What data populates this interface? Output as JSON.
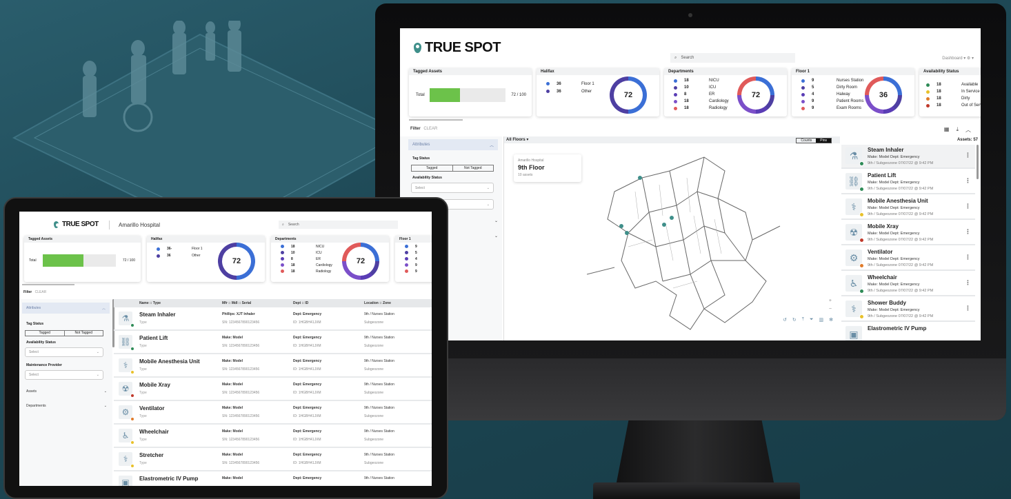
{
  "desktop": {
    "logo": "TRUE SPOT",
    "search_placeholder": "Search",
    "menu": "Dashboard ▾   ⚙ ▾",
    "tagged": {
      "title": "Tagged Assets",
      "label": "Total",
      "value": "72 / 100",
      "fraction": 0.72
    },
    "halifax": {
      "title": "Halifax",
      "total": "72",
      "items": [
        {
          "count": "36",
          "label": "Floor 1",
          "color": "#3b6fd6"
        },
        {
          "count": "36",
          "label": "Other",
          "color": "#4e3fa2"
        }
      ]
    },
    "departments": {
      "title": "Departments",
      "total": "72",
      "items": [
        {
          "count": "18",
          "label": "NICU",
          "color": "#3b6fd6"
        },
        {
          "count": "10",
          "label": "ICU",
          "color": "#4e3fa2"
        },
        {
          "count": "8",
          "label": "ER",
          "color": "#5a3db5"
        },
        {
          "count": "18",
          "label": "Cardiology",
          "color": "#7b4fc9"
        },
        {
          "count": "18",
          "label": "Radiology",
          "color": "#e05a5a"
        }
      ]
    },
    "floor1": {
      "title": "Floor 1",
      "total": "36",
      "items": [
        {
          "count": "9",
          "label": "Nurses Station",
          "color": "#3b6fd6"
        },
        {
          "count": "5",
          "label": "Dirty Room",
          "color": "#4e3fa2"
        },
        {
          "count": "4",
          "label": "Halway",
          "color": "#5a3db5"
        },
        {
          "count": "9",
          "label": "Patient Rooms",
          "color": "#7b4fc9"
        },
        {
          "count": "9",
          "label": "Exam Rooms",
          "color": "#e05a5a"
        }
      ]
    },
    "availability": {
      "title": "Availability Status",
      "items": [
        {
          "count": "18",
          "label": "Available",
          "color": "#2e8b57"
        },
        {
          "count": "18",
          "label": "In Service",
          "color": "#e8c12a"
        },
        {
          "count": "18",
          "label": "Dirty",
          "color": "#e07b2a"
        },
        {
          "count": "18",
          "label": "Out of Serv",
          "color": "#c0392b"
        }
      ]
    },
    "filter": {
      "label": "Filter",
      "action": "CLEAR"
    },
    "sidebar": {
      "attributes": "Attributes",
      "tag_status": "Tag Status",
      "tagged": "Tagged",
      "not_tagged": "Not Tagged",
      "availability_status": "Availability Status",
      "select": "Select"
    },
    "map": {
      "floors": "All Floors ▾",
      "counts": "Counts",
      "pins": "Pins",
      "hospital": "Amarillo Hospital",
      "floor": "9th Floor",
      "assets": "10 assets"
    },
    "assets_count": "Assets: 57",
    "assets": [
      {
        "name": "Steam Inhaler",
        "make": "Make: Model",
        "dept": "Dept: Emergency",
        "loc": "9th / Subgeozone  07/07/22 @ 9:42 PM",
        "status": "#2e8b57",
        "icon": "inhaler-icon"
      },
      {
        "name": "Patient Lift",
        "make": "Make: Model",
        "dept": "Dept: Emergency",
        "loc": "9th / Subgeozone  07/07/22 @ 9:42 PM",
        "status": "#2e8b57",
        "icon": "lift-icon"
      },
      {
        "name": "Mobile Anesthesia Unit",
        "make": "Make: Model",
        "dept": "Dept: Emergency",
        "loc": "9th / Subgeozone  07/07/22 @ 9:42 PM",
        "status": "#e8c12a",
        "icon": "anesthesia-icon"
      },
      {
        "name": "Mobile Xray",
        "make": "Make: Model",
        "dept": "Dept: Emergency",
        "loc": "9th / Subgeozone  07/07/22 @ 9:42 PM",
        "status": "#c0392b",
        "icon": "xray-icon"
      },
      {
        "name": "Ventilator",
        "make": "Make: Model",
        "dept": "Dept: Emergency",
        "loc": "9th / Subgeozone  07/07/22 @ 9:42 PM",
        "status": "#e07b2a",
        "icon": "ventilator-icon"
      },
      {
        "name": "Wheelchair",
        "make": "Make: Model",
        "dept": "Dept: Emergency",
        "loc": "9th / Subgeozone  07/07/22 @ 9:42 PM",
        "status": "#2e8b57",
        "icon": "wheelchair-icon"
      },
      {
        "name": "Shower Buddy",
        "make": "Make: Model",
        "dept": "Dept: Emergency",
        "loc": "9th / Subgeozone  07/07/22 @ 9:42 PM",
        "status": "#e8c12a",
        "icon": "shower-icon"
      },
      {
        "name": "Elastrometric IV Pump",
        "make": "",
        "dept": "",
        "loc": "",
        "status": "",
        "icon": "iv-pump-icon"
      }
    ]
  },
  "tablet": {
    "logo": "TRUE SPOT",
    "hospital": "Amarillo Hospital",
    "search_placeholder": "Search",
    "tagged": {
      "title": "Tagged Assets",
      "label": "Total",
      "value": "72 / 100",
      "fraction": 0.72
    },
    "halifax": {
      "title": "Halifax",
      "total": "72",
      "items": [
        {
          "count": "36-",
          "label": "Floor 1",
          "color": "#3b6fd6"
        },
        {
          "count": "36",
          "label": "Other",
          "color": "#4e3fa2"
        }
      ]
    },
    "departments": {
      "title": "Departments",
      "total": "72",
      "items": [
        {
          "count": "18",
          "label": "NICU",
          "color": "#3b6fd6"
        },
        {
          "count": "10",
          "label": "ICU",
          "color": "#4e3fa2"
        },
        {
          "count": "8",
          "label": "ER",
          "color": "#5a3db5"
        },
        {
          "count": "18",
          "label": "Cardiology",
          "color": "#7b4fc9"
        },
        {
          "count": "18",
          "label": "Radiology",
          "color": "#e05a5a"
        }
      ]
    },
    "floor1": {
      "title": "Floor 1",
      "counts": [
        "9",
        "5",
        "4",
        "9",
        "9"
      ]
    },
    "filter": {
      "label": "Filter",
      "action": "CLEAR"
    },
    "sidebar": {
      "attributes": "Attributes",
      "tag_status": "Tag Status",
      "tagged": "Tagged",
      "not_tagged": "Not Tagged",
      "availability_status": "Availability Status",
      "maintenance_provider": "Maintenance Provider",
      "select": "Select",
      "assets": "Assets",
      "departments": "Departments"
    },
    "columns": [
      "Name :: Type",
      "Mfr :: Mdl :: Serial",
      "Dept :: ID",
      "Location :: Zone"
    ],
    "rows": [
      {
        "name": "Steam Inhaler",
        "type": "Type",
        "mfr": "Phillips: XJT Inhaler",
        "sn": "SN: 1234567890123456",
        "dept": "Dept: Emergency",
        "id": "ID: 1HGBH41JXM",
        "loc": "9th / Nurses Station",
        "zone": "Subgeozone",
        "status": "#2e8b57",
        "icon": "inhaler-icon"
      },
      {
        "name": "Patient Lift",
        "type": "Type",
        "mfr": "Make: Model",
        "sn": "SN: 1234567890123456",
        "dept": "Dept: Emergency",
        "id": "ID: 1HGBH41JXM",
        "loc": "9th / Nurses Station",
        "zone": "Subgeozone",
        "status": "#2e8b57",
        "icon": "lift-icon"
      },
      {
        "name": "Mobile Anesthesia Unit",
        "type": "Type",
        "mfr": "Make: Model",
        "sn": "SN: 1234567890123456",
        "dept": "Dept: Emergency",
        "id": "ID: 1HGBH41JXM",
        "loc": "9th / Nurses Station",
        "zone": "Subgeozone",
        "status": "#e8c12a",
        "icon": "anesthesia-icon"
      },
      {
        "name": "Mobile Xray",
        "type": "Type",
        "mfr": "Make: Model",
        "sn": "SN: 1234567890123456",
        "dept": "Dept: Emergency",
        "id": "ID: 1HGBH41JXM",
        "loc": "9th / Nurses Station",
        "zone": "Subgeozone",
        "status": "#c0392b",
        "icon": "xray-icon"
      },
      {
        "name": "Ventilator",
        "type": "Type",
        "mfr": "Make: Model",
        "sn": "SN: 1234567890123456",
        "dept": "Dept: Emergency",
        "id": "ID: 1HGBH41JXM",
        "loc": "9th / Nurses Station",
        "zone": "Subgeozone",
        "status": "#e07b2a",
        "icon": "ventilator-icon"
      },
      {
        "name": "Wheelchair",
        "type": "Type",
        "mfr": "Make: Model",
        "sn": "SN: 1234567890123456",
        "dept": "Dept: Emergency",
        "id": "ID: 1HGBH41JXM",
        "loc": "9th / Nurses Station",
        "zone": "Subgeozone",
        "status": "#e8c12a",
        "icon": "wheelchair-icon"
      },
      {
        "name": "Stretcher",
        "type": "Type",
        "mfr": "Make: Model",
        "sn": "SN: 1234567890123456",
        "dept": "Dept: Emergency",
        "id": "ID: 1HGBH41JXM",
        "loc": "9th / Nurses Station",
        "zone": "Subgeozone",
        "status": "#e8c12a",
        "icon": "stretcher-icon"
      },
      {
        "name": "Elastrometric IV Pump",
        "type": "",
        "mfr": "Make: Model",
        "sn": "",
        "dept": "Dept: Emergency",
        "id": "",
        "loc": "9th / Nurses Station",
        "zone": "",
        "status": "",
        "icon": "iv-pump-icon"
      }
    ]
  }
}
